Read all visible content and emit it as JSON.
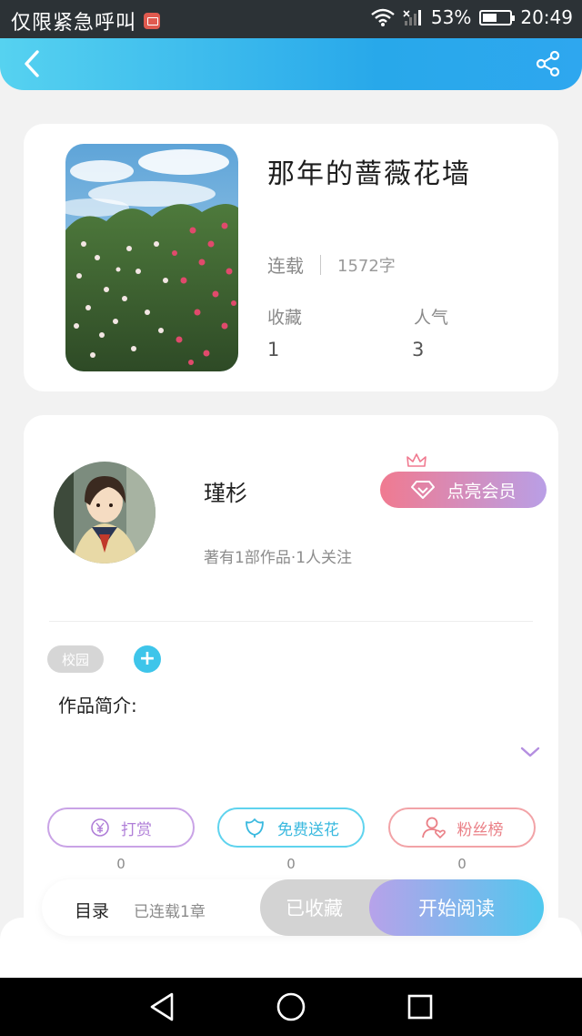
{
  "status_bar": {
    "carrier": "仅限紧急呼叫",
    "battery_percent": "53%",
    "battery_level": 0.53,
    "time": "20:49",
    "icons": [
      "mail-icon",
      "wifi-icon",
      "signal-icon",
      "battery-icon"
    ]
  },
  "header": {
    "back_icon": "chevron-left-icon",
    "share_icon": "share-icon",
    "gradient": [
      "#56d2f0",
      "#28a8ea"
    ]
  },
  "book": {
    "title": "那年的蔷薇花墙",
    "status": "连载",
    "word_count": "1572字",
    "favorites_label": "收藏",
    "favorites_value": "1",
    "popularity_label": "人气",
    "popularity_value": "3"
  },
  "author": {
    "name": "瑾杉",
    "summary": "著有1部作品·1人关注",
    "vip_button": "点亮会员"
  },
  "tags": [
    "校园"
  ],
  "intro": {
    "label": "作品简介:"
  },
  "actions": [
    {
      "label": "打赏",
      "count": "0",
      "icon": "yen-icon",
      "color": "#b07fd8"
    },
    {
      "label": "免费送花",
      "count": "0",
      "icon": "flower-icon",
      "color": "#3ab9df"
    },
    {
      "label": "粉丝榜",
      "count": "0",
      "icon": "user-heart-icon",
      "color": "#ea7f86"
    }
  ],
  "bottom_bar": {
    "toc_label": "目录",
    "toc_sub": "已连载1章",
    "faved_button": "已收藏",
    "read_button": "开始阅读"
  },
  "nav_bar": {
    "icons": [
      "back-triangle-icon",
      "home-circle-icon",
      "recents-square-icon"
    ]
  }
}
